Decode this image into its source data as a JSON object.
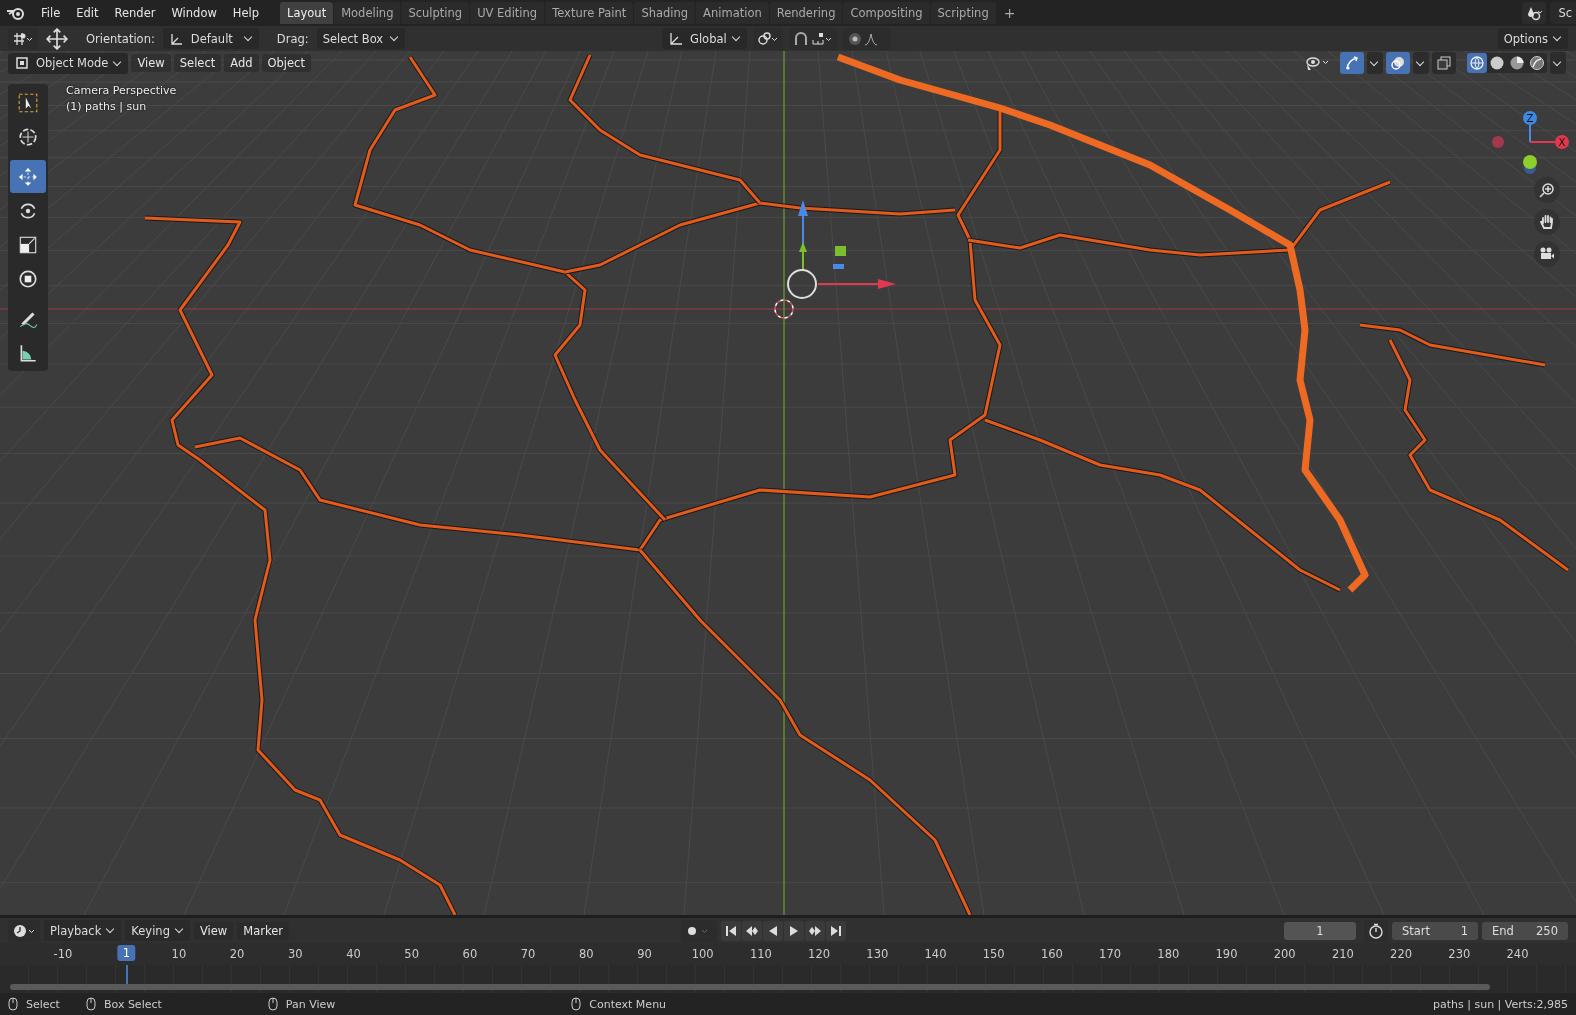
{
  "top_bar": {
    "menus": [
      "File",
      "Edit",
      "Render",
      "Window",
      "Help"
    ],
    "workspaces": [
      {
        "label": "Layout",
        "selected": true
      },
      {
        "label": "Modeling",
        "selected": false
      },
      {
        "label": "Sculpting",
        "selected": false
      },
      {
        "label": "UV Editing",
        "selected": false
      },
      {
        "label": "Texture Paint",
        "selected": false
      },
      {
        "label": "Shading",
        "selected": false
      },
      {
        "label": "Animation",
        "selected": false
      },
      {
        "label": "Rendering",
        "selected": false
      },
      {
        "label": "Compositing",
        "selected": false
      },
      {
        "label": "Scripting",
        "selected": false
      }
    ],
    "add_tab": "+",
    "scene": "Sc"
  },
  "tool_header": {
    "orientation_label": "Orientation:",
    "orientation": "Default",
    "drag_label": "Drag:",
    "drag": "Select Box",
    "transform_orientation": "Global",
    "options": "Options"
  },
  "viewport": {
    "mode": "Object Mode",
    "menus": [
      "View",
      "Select",
      "Add",
      "Object"
    ],
    "overlay_lines": [
      "Camera Perspective",
      "(1) paths | sun"
    ],
    "tools": [
      {
        "selected": false
      },
      {
        "selected": false
      },
      {
        "selected": true
      },
      {
        "selected": false
      },
      {
        "selected": false
      },
      {
        "selected": false
      },
      {
        "selected": false
      },
      {
        "selected": false
      }
    ],
    "shading_modes": [
      {
        "selected": true
      },
      {
        "selected": false
      },
      {
        "selected": false
      },
      {
        "selected": false
      }
    ],
    "axis_labels": [
      "Z",
      "X"
    ]
  },
  "timeline": {
    "menus": [
      "Playback",
      "Keying",
      "View",
      "Marker"
    ],
    "current_frame": "1",
    "start_label": "Start",
    "start": "1",
    "end_label": "End",
    "end": "250",
    "playhead": "1",
    "ruler_ticks": [
      "-10",
      "10",
      "20",
      "30",
      "40",
      "50",
      "60",
      "70",
      "80",
      "90",
      "100",
      "110",
      "120",
      "130",
      "140",
      "150",
      "160",
      "170",
      "180",
      "190",
      "200",
      "210",
      "220",
      "230",
      "240"
    ]
  },
  "status_bar": {
    "hints": [
      "Select",
      "Box Select",
      "Pan View",
      "Context Menu"
    ],
    "stats": "paths | sun | Verts:2,985"
  }
}
